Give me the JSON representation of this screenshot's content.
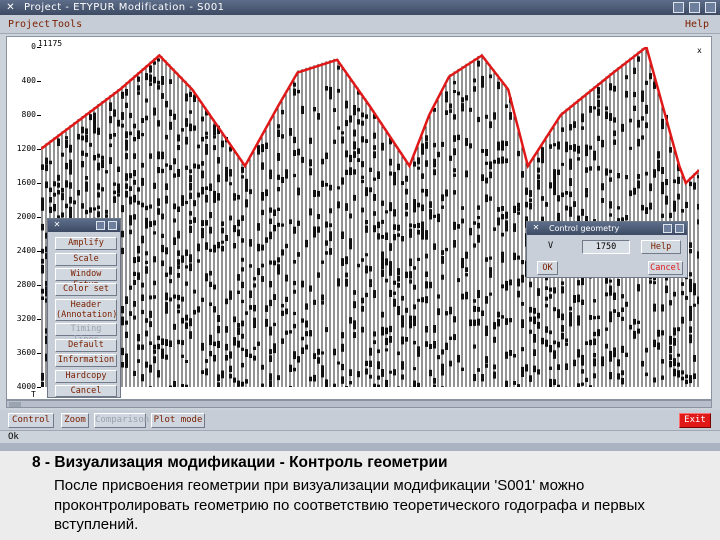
{
  "window": {
    "title": "Project - ETYPUR Modification - S001"
  },
  "menubar": {
    "left1": "Project",
    "left2": "Tools",
    "right": "Help"
  },
  "plot": {
    "top_label": "11175",
    "x_marker": "x",
    "t_marker": "T",
    "y_ticks": [
      "0",
      "400",
      "800",
      "1200",
      "1600",
      "2000",
      "2400",
      "2800",
      "3200",
      "3600",
      "4000"
    ]
  },
  "chart_data": {
    "type": "line",
    "title": "",
    "xlabel": "",
    "ylabel": "",
    "ylim": [
      4000,
      0
    ],
    "xlim": [
      0,
      100
    ],
    "series": [
      {
        "x": [
          0,
          12,
          18,
          23,
          31,
          36,
          39,
          45,
          50,
          56,
          59,
          62,
          67,
          71,
          74,
          79,
          87,
          92,
          97,
          98,
          100
        ],
        "y": [
          1200,
          500,
          100,
          500,
          1400,
          700,
          300,
          150,
          700,
          1400,
          800,
          350,
          100,
          500,
          1400,
          800,
          300,
          0,
          1400,
          1600,
          1450
        ]
      }
    ]
  },
  "side_menu": {
    "title": "",
    "items": [
      {
        "label": "Amplify",
        "disabled": false
      },
      {
        "label": "Scale",
        "disabled": false
      },
      {
        "label": "Window Setup",
        "disabled": false
      },
      {
        "label": "Color set",
        "disabled": false
      },
      {
        "label": "Header\n(Annotation)",
        "disabled": false
      },
      {
        "label": "Timing lines",
        "disabled": true
      },
      {
        "label": "Default",
        "disabled": false
      },
      {
        "label": "Information",
        "disabled": false
      },
      {
        "label": "Hardcopy",
        "disabled": false
      },
      {
        "label": "Cancel",
        "disabled": false
      }
    ]
  },
  "geometry_dialog": {
    "title": "Control geometry",
    "field_label": "V",
    "field_value": "1750",
    "help": "Help",
    "ok": "OK",
    "cancel": "Cancel"
  },
  "bottom_buttons": {
    "control": "Control",
    "zoom": "Zoom",
    "comparison": "Comparison",
    "plot_mode": "Plot mode",
    "exit": "Exit"
  },
  "status": "Ok",
  "slide": {
    "headline": "8 - Визуализация модификации   -  Контроль геометрии",
    "description": "После присвоения геометрии при визуализации модификации 'S001' можно проконтролировать геометрию по соответствию теоретического годографа и первых вступлений."
  },
  "colors": {
    "curve": "#e01818",
    "accent_red": "#e01818",
    "title_bar": "#4a5874",
    "button_text": "#7a2000"
  }
}
